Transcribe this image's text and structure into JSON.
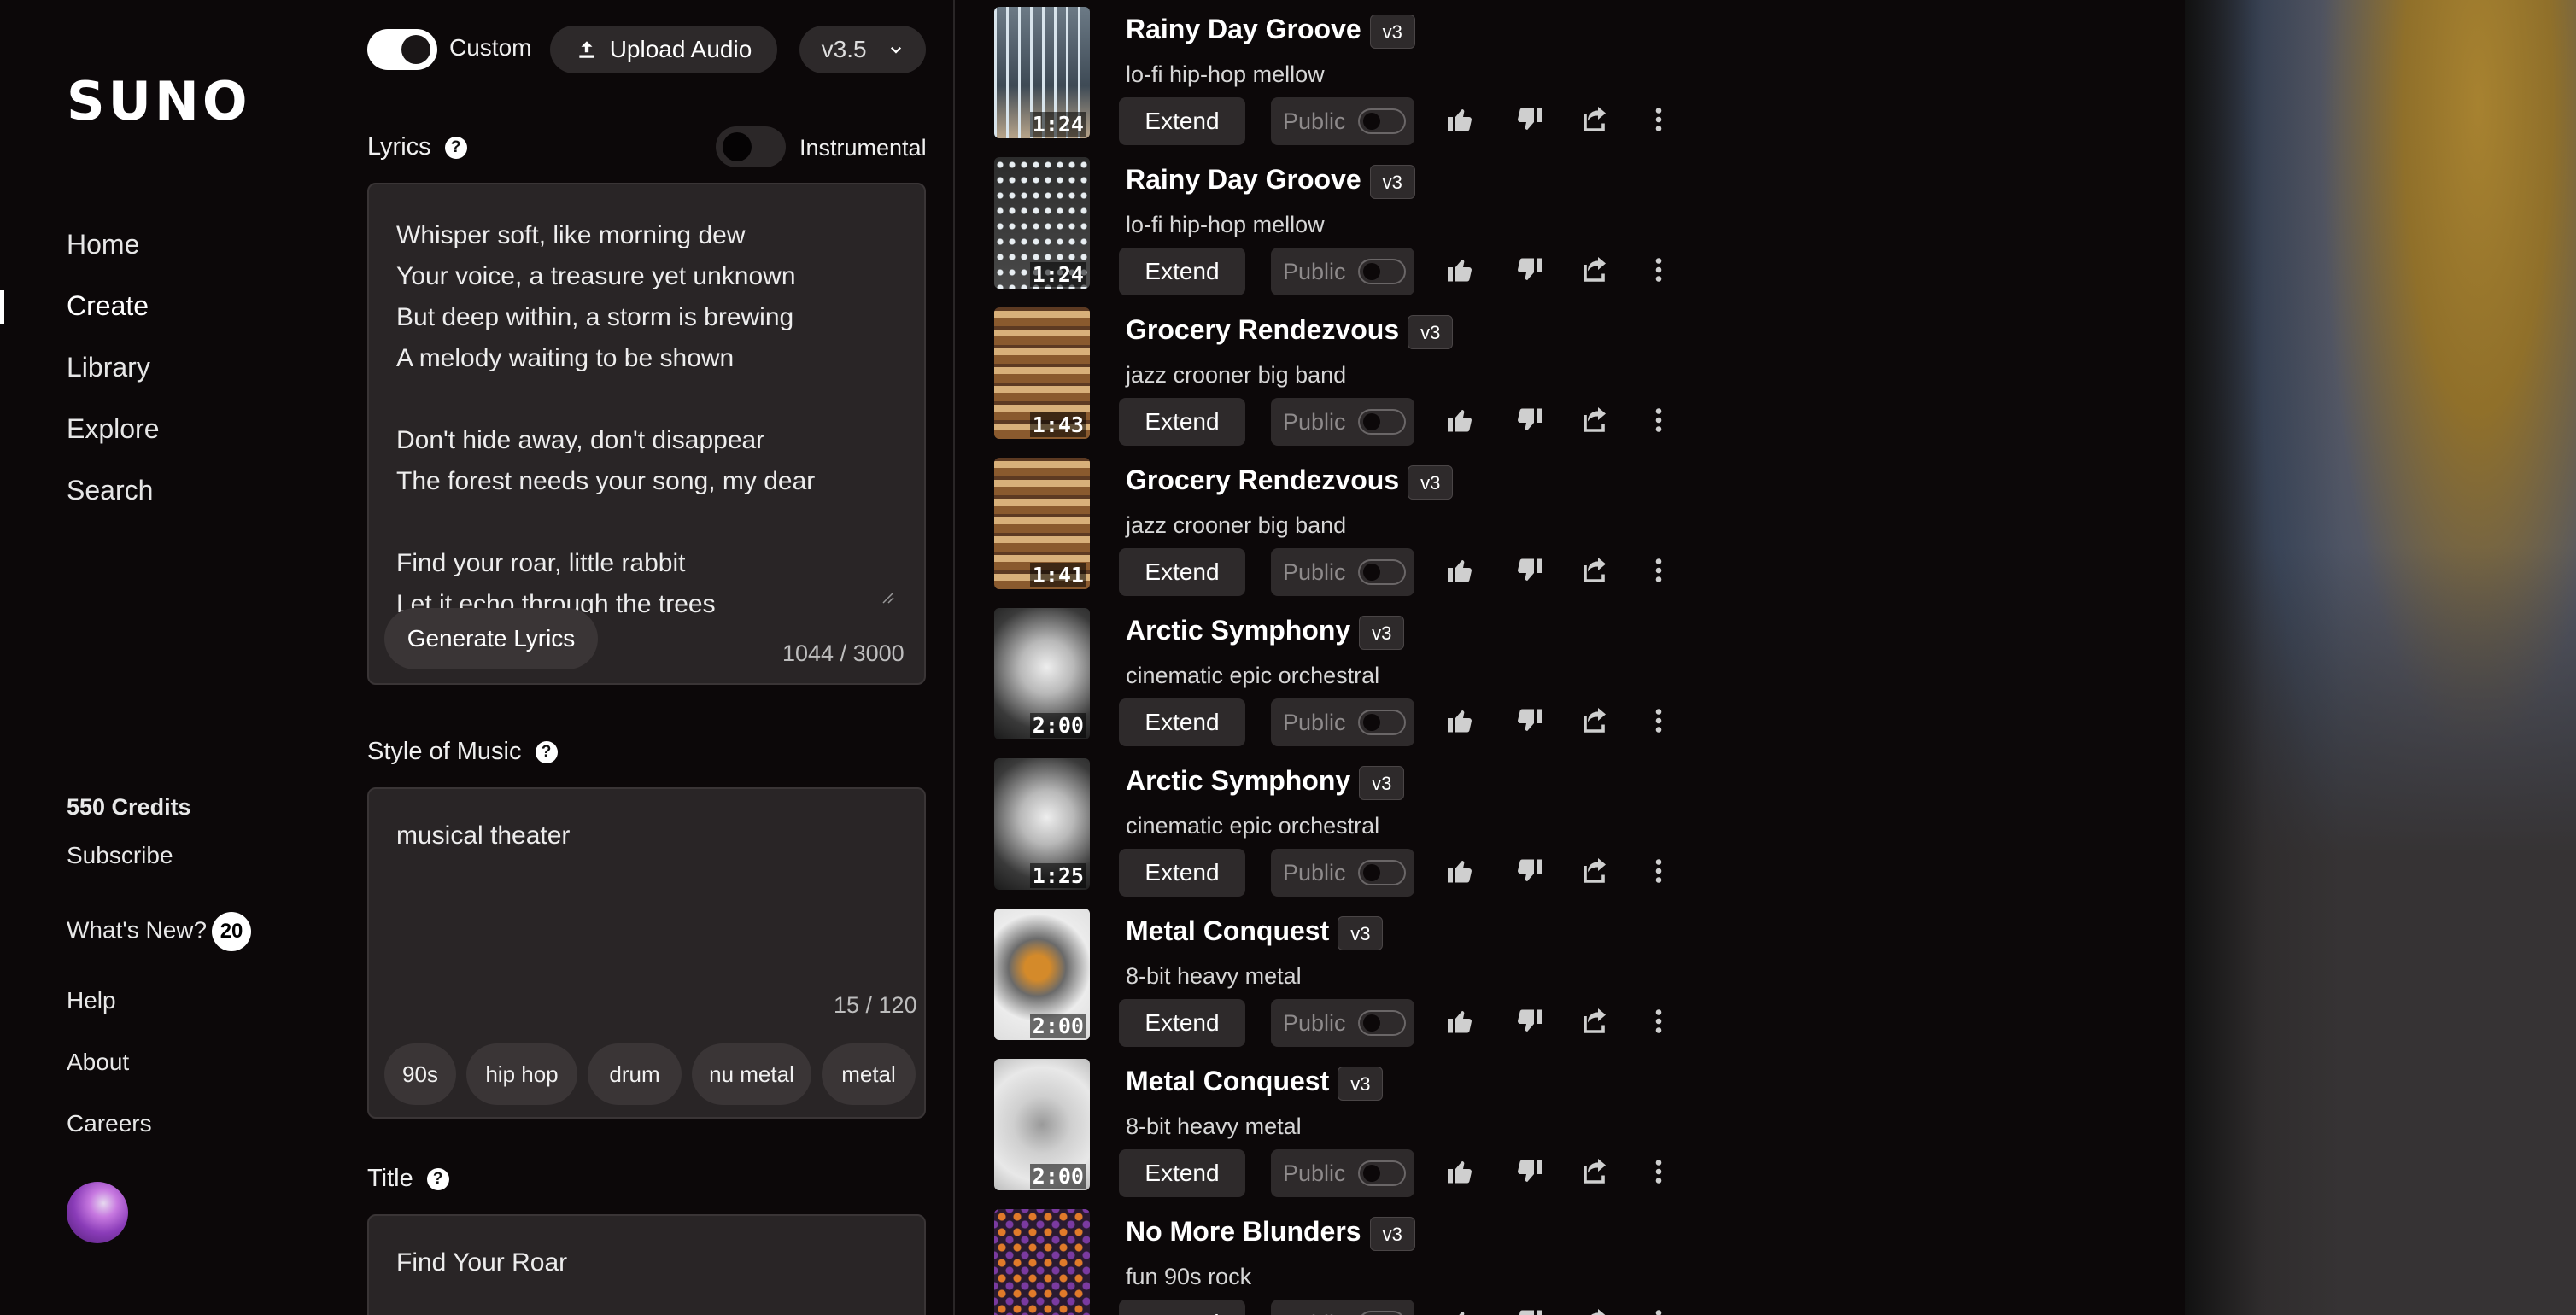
{
  "sidebar": {
    "logo": "SUNO",
    "nav": [
      "Home",
      "Create",
      "Library",
      "Explore",
      "Search"
    ],
    "credits": "550 Credits",
    "subscribe": "Subscribe",
    "whats_new": "What's New?",
    "whats_new_count": "20",
    "help": "Help",
    "about": "About",
    "careers": "Careers"
  },
  "create": {
    "custom_label": "Custom",
    "upload_label": "Upload Audio",
    "version": "v3.5",
    "lyrics_label": "Lyrics",
    "instrumental_label": "Instrumental",
    "lyrics": "Whisper soft, like morning dew\nYour voice, a treasure yet unknown\nBut deep within, a storm is brewing\nA melody waiting to be shown\n\nDon't hide away, don't disappear\nThe forest needs your song, my dear\n\nFind your roar, little rabbit\nLet it echo through the trees",
    "generate_lyrics": "Generate Lyrics",
    "lyrics_count": "1044 / 3000",
    "style_label": "Style of Music",
    "style_value": "musical theater",
    "style_count": "15 / 120",
    "style_tags": [
      "90s",
      "hip hop",
      "drum",
      "nu metal",
      "metal"
    ],
    "title_label": "Title",
    "title_value": "Find Your Roar"
  },
  "songs": [
    {
      "title": "Rainy Day Groove",
      "version": "v3",
      "tags": "lo-fi hip-hop mellow",
      "duration": "1:24",
      "theme": "rain"
    },
    {
      "title": "Rainy Day Groove",
      "version": "v3",
      "tags": "lo-fi hip-hop mellow",
      "duration": "1:24",
      "theme": "rain2"
    },
    {
      "title": "Grocery Rendezvous",
      "version": "v3",
      "tags": "jazz crooner big band",
      "duration": "1:43",
      "theme": "grocery"
    },
    {
      "title": "Grocery Rendezvous",
      "version": "v3",
      "tags": "jazz crooner big band",
      "duration": "1:41",
      "theme": "grocery"
    },
    {
      "title": "Arctic Symphony",
      "version": "v3",
      "tags": "cinematic epic orchestral",
      "duration": "2:00",
      "theme": "bird-bw"
    },
    {
      "title": "Arctic Symphony",
      "version": "v3",
      "tags": "cinematic epic orchestral",
      "duration": "1:25",
      "theme": "bird-bw"
    },
    {
      "title": "Metal Conquest",
      "version": "v3",
      "tags": "8-bit heavy metal",
      "duration": "2:00",
      "theme": "robin"
    },
    {
      "title": "Metal Conquest",
      "version": "v3",
      "tags": "8-bit heavy metal",
      "duration": "2:00",
      "theme": "bird-sketch"
    },
    {
      "title": "No More Blunders",
      "version": "v3",
      "tags": "fun 90s rock",
      "duration": "",
      "theme": "guitars"
    }
  ],
  "song_actions": {
    "extend": "Extend",
    "public": "Public"
  },
  "icons": [
    "upload-icon",
    "chevron-down-icon",
    "help-icon",
    "thumbs-up-icon",
    "thumbs-down-icon",
    "share-icon",
    "more-icon"
  ]
}
